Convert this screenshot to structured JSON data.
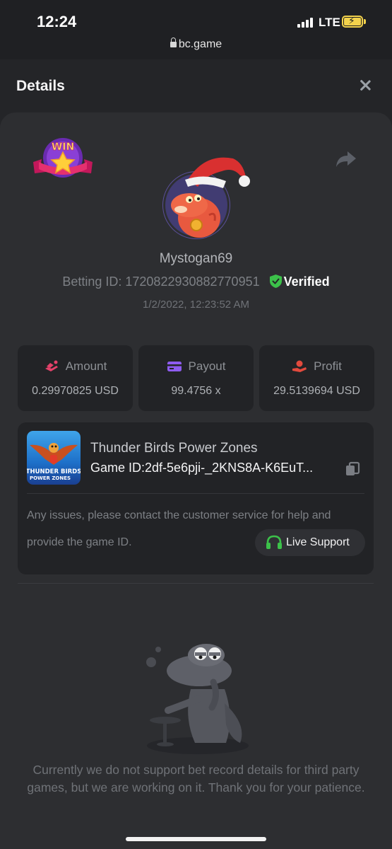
{
  "status_bar": {
    "time": "12:24",
    "network": "LTE",
    "url": "bc.game"
  },
  "header": {
    "title": "Details"
  },
  "bet": {
    "badge": "WIN",
    "username": "Mystogan69",
    "betting_id_label": "Betting ID:",
    "betting_id": "1720822930882770951",
    "verified": "Verified",
    "timestamp": "1/2/2022, 12:23:52 AM"
  },
  "stats": [
    {
      "label": "Amount",
      "value": "0.29970825 USD",
      "icon": "amount-icon"
    },
    {
      "label": "Payout",
      "value": "99.4756 x",
      "icon": "payout-icon"
    },
    {
      "label": "Profit",
      "value": "29.5139694 USD",
      "icon": "profit-icon"
    }
  ],
  "game": {
    "name": "Thunder Birds Power Zones",
    "game_id_label": "Game ID:",
    "game_id": "2df-5e6pji-_2KNS8A-K6EuT...",
    "thumb_line1": "THUNDER BIRDS",
    "thumb_line2": "POWER ZONES",
    "issue_line1": "Any issues, please contact the customer service for help and",
    "issue_line2": "provide the game ID.",
    "support_label": "Live Support"
  },
  "notice": "Currently we do not support bet record details for third party games, but we are working on it. Thank you for your patience.",
  "colors": {
    "verified_green": "#3cc14a",
    "support_green": "#3cc14a",
    "amount_icon": "#e5416a",
    "payout_icon": "#8e5cf0",
    "profit_icon": "#e24a3d",
    "battery": "#f3d24c"
  }
}
